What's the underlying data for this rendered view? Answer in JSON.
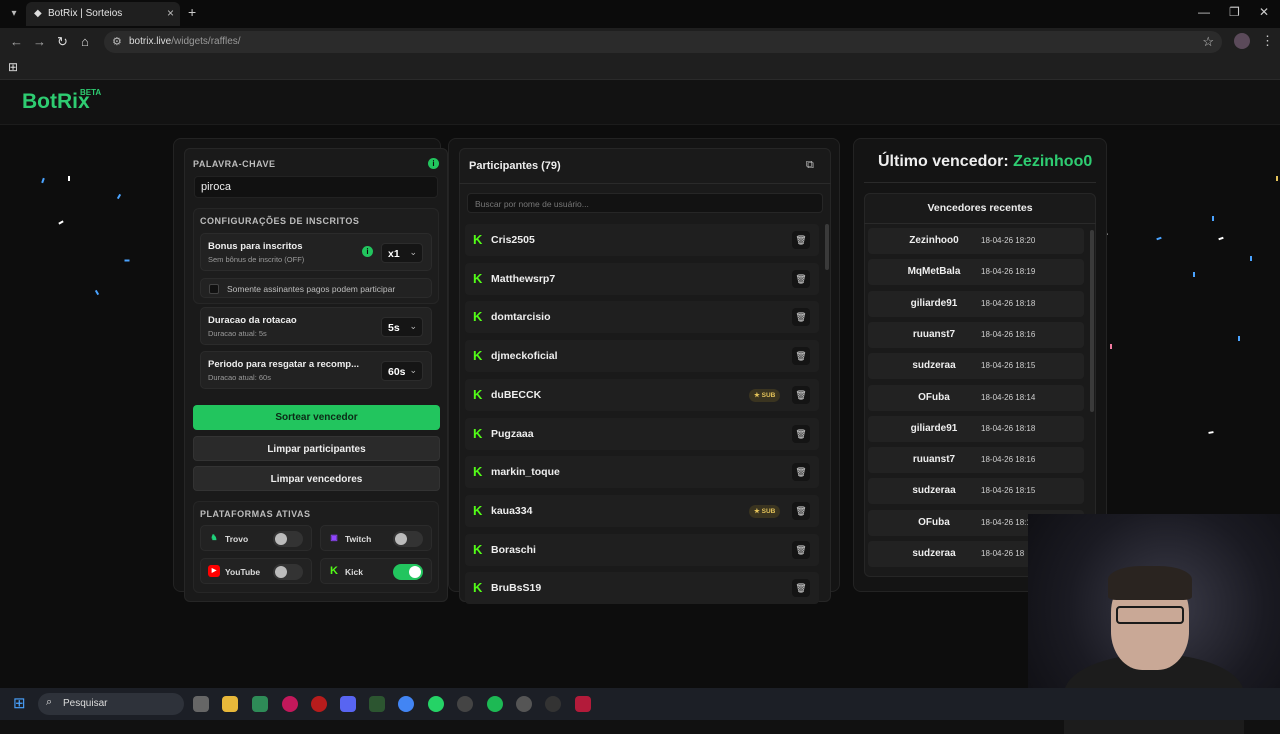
{
  "browser": {
    "tab_title": "BotRix | Sorteios",
    "url_host": "botrix.live",
    "url_path": "/widgets/raffles/"
  },
  "site": {
    "logo": "BotRix",
    "logo_badge": "BETA"
  },
  "left_panel": {
    "keyword_label": "PALAVRA-CHAVE",
    "keyword_value": "piroca",
    "subs_config_label": "CONFIGURAÇÕES DE INSCRITOS",
    "bonus": {
      "title": "Bonus para inscritos",
      "sub": "Sem bônus de inscrito (OFF)",
      "value": "x1"
    },
    "paid_only_label": "Somente assinantes pagos podem participar",
    "rotation": {
      "title": "Duracao da rotacao",
      "sub": "Duracao atual: 5s",
      "value": "5s"
    },
    "redeem": {
      "title": "Periodo para resgatar a recomp...",
      "sub": "Duracao atual: 60s",
      "value": "60s"
    },
    "draw_button": "Sortear vencedor",
    "clear_participants_button": "Limpar participantes",
    "clear_winners_button": "Limpar vencedores",
    "platforms_label": "PLATAFORMAS ATIVAS",
    "platforms": [
      {
        "name": "Trovo",
        "enabled": false,
        "color": "#1fd17a"
      },
      {
        "name": "Twitch",
        "enabled": false,
        "color": "#9146ff"
      },
      {
        "name": "YouTube",
        "enabled": false,
        "color": "#ff0000"
      },
      {
        "name": "Kick",
        "enabled": true,
        "color": "#53fc18"
      }
    ]
  },
  "participants": {
    "title": "Participantes (79)",
    "search_placeholder": "Buscar por nome de usuário...",
    "sub_badge": "SUB",
    "list": [
      {
        "name": "Cris2505",
        "sub": false
      },
      {
        "name": "Matthewsrp7",
        "sub": false
      },
      {
        "name": "domtarcisio",
        "sub": false
      },
      {
        "name": "djmeckoficial",
        "sub": false
      },
      {
        "name": "duBECCK",
        "sub": true
      },
      {
        "name": "Pugzaaa",
        "sub": false
      },
      {
        "name": "markin_toque",
        "sub": false
      },
      {
        "name": "kaua334",
        "sub": true
      },
      {
        "name": "Boraschi",
        "sub": false
      },
      {
        "name": "BruBsS19",
        "sub": false
      }
    ]
  },
  "winners": {
    "last_label": "Último vencedor:",
    "last_name": "Zezinhoo0",
    "recent_title": "Vencedores recentes",
    "list": [
      {
        "name": "Zezinhoo0",
        "time": "18-04-26 18:20"
      },
      {
        "name": "MqMetBala",
        "time": "18-04-26 18:19"
      },
      {
        "name": "giliarde91",
        "time": "18-04-26 18:18"
      },
      {
        "name": "ruuanst7",
        "time": "18-04-26 18:16"
      },
      {
        "name": "sudzeraa",
        "time": "18-04-26 18:15"
      },
      {
        "name": "OFuba",
        "time": "18-04-26 18:14"
      },
      {
        "name": "giliarde91",
        "time": "18-04-26 18:18"
      },
      {
        "name": "ruuanst7",
        "time": "18-04-26 18:16"
      },
      {
        "name": "sudzeraa",
        "time": "18-04-26 18:15"
      },
      {
        "name": "OFuba",
        "time": "18-04-26 18:1"
      },
      {
        "name": "sudzeraa",
        "time": "18-04-26 18"
      }
    ]
  },
  "taskbar": {
    "search_label": "Pesquisar"
  },
  "colors": {
    "accent": "#22c55e",
    "kick": "#53fc18"
  }
}
